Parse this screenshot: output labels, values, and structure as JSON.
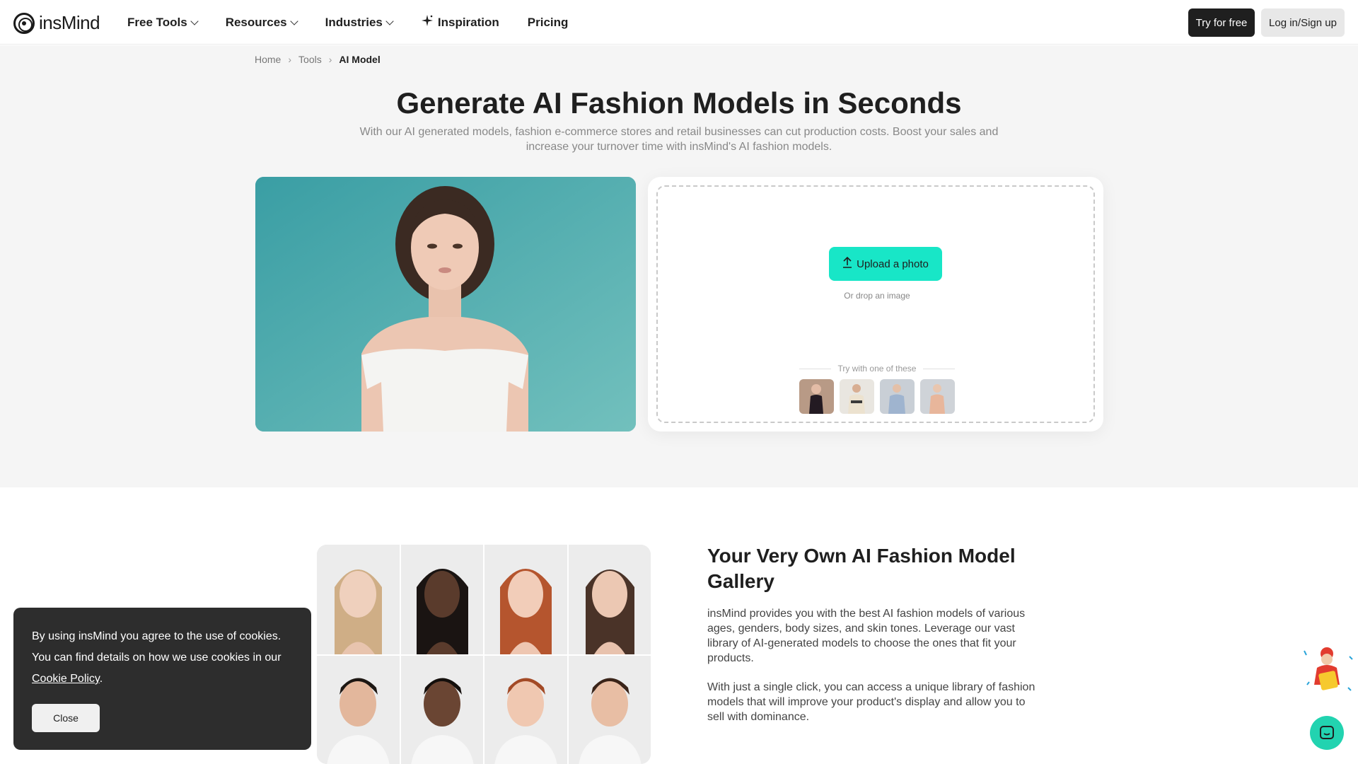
{
  "brand": {
    "name": "insMind"
  },
  "nav": {
    "items": [
      {
        "label": "Free Tools",
        "dropdown": true
      },
      {
        "label": "Resources",
        "dropdown": true
      },
      {
        "label": "Industries",
        "dropdown": true
      },
      {
        "label": "Inspiration",
        "icon": "sparkle-icon"
      },
      {
        "label": "Pricing"
      }
    ],
    "try_label": "Try for free",
    "login_label": "Log in/Sign up"
  },
  "breadcrumb": {
    "home": "Home",
    "tools": "Tools",
    "current": "AI Model"
  },
  "hero": {
    "title": "Generate AI Fashion Models in Seconds",
    "subtitle": "With our AI generated models, fashion e-commerce stores and retail businesses can cut production costs. Boost your sales and increase your turnover time with insMind's AI fashion models."
  },
  "upload": {
    "button_label": "Upload a photo",
    "drop_text": "Or drop an image",
    "try_text": "Try with one of these"
  },
  "gallery": {
    "title": "Your Very Own AI Fashion Model Gallery",
    "p1": "insMind provides you with the best AI fashion models of various ages, genders, body sizes, and skin tones. Leverage our vast library of AI-generated models to choose the ones that fit your products.",
    "p2": "With just a single click, you can access a unique library of fashion models that will improve your product's display and allow you to sell with dominance."
  },
  "cookie": {
    "text_before": "By using insMind you agree to the use of cookies. You can find details on how we use cookies in our ",
    "link": "Cookie Policy",
    "text_after": ".",
    "close_label": "Close"
  },
  "colors": {
    "accent": "#18e6c7",
    "dark": "#1f1f1f",
    "hero_bg": "#f5f5f5",
    "chat": "#22d3b0"
  }
}
